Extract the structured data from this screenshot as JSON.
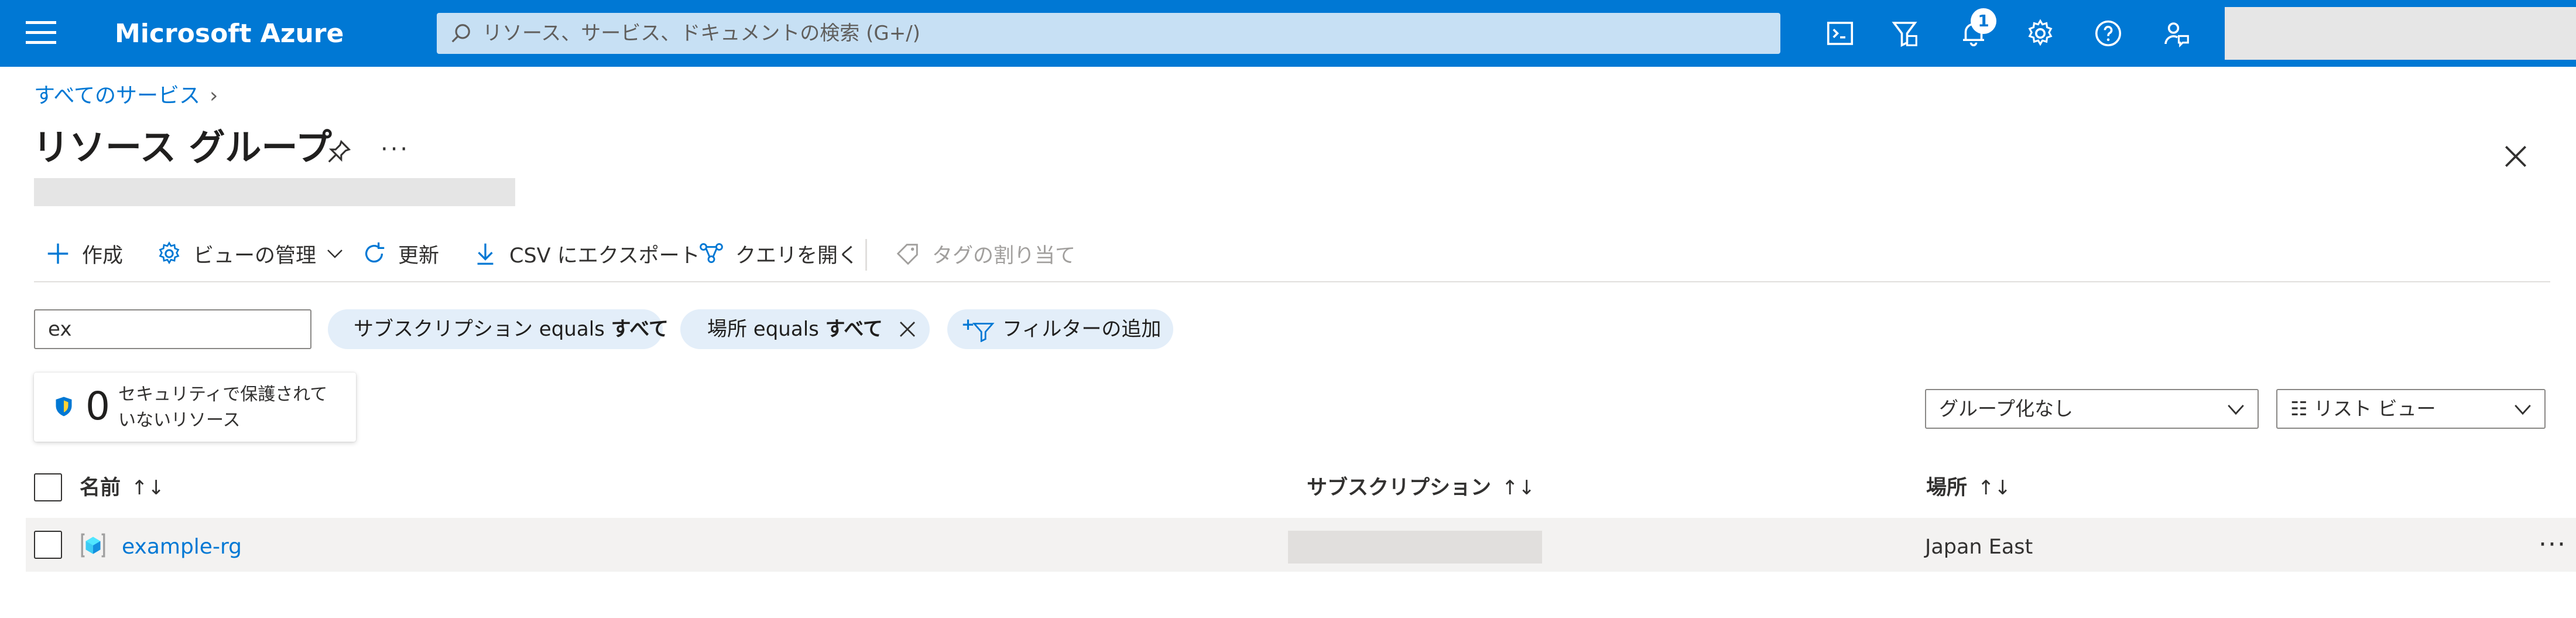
{
  "topbar": {
    "brand": "Microsoft Azure",
    "search_placeholder": "リソース、サービス、ドキュメントの検索 (G+/)",
    "notification_count": "1",
    "icons": [
      "cloud-shell-icon",
      "directory-filter-icon",
      "notifications-icon",
      "settings-icon",
      "help-icon",
      "feedback-icon"
    ],
    "accent_color": "#0078d4"
  },
  "breadcrumb": {
    "root": "すべてのサービス",
    "separator": "›"
  },
  "page": {
    "title": "リソース グループ",
    "more": "···"
  },
  "commands": {
    "create": "作成",
    "manage_view": "ビューの管理",
    "refresh": "更新",
    "export_csv": "CSV にエクスポート",
    "open_query": "クエリを開く",
    "assign_tags": "タグの割り当て"
  },
  "filters": {
    "search_value": "ex",
    "subscription_pill": {
      "prefix": "サブスクリプション equals ",
      "value": "すべて"
    },
    "location_pill": {
      "prefix": "場所 equals ",
      "value": "すべて"
    },
    "add_filter": "フィルターの追加"
  },
  "security_card": {
    "count": "0",
    "label": "セキュリティで保護されていないリソース"
  },
  "dropdowns": {
    "grouping": "グループ化なし",
    "view": "☷ リスト ビュー"
  },
  "table": {
    "columns": {
      "name": "名前",
      "subscription": "サブスクリプション",
      "location": "場所"
    },
    "sort_glyph": "↑↓",
    "rows": [
      {
        "name": "example-rg",
        "location": "Japan East"
      }
    ]
  }
}
